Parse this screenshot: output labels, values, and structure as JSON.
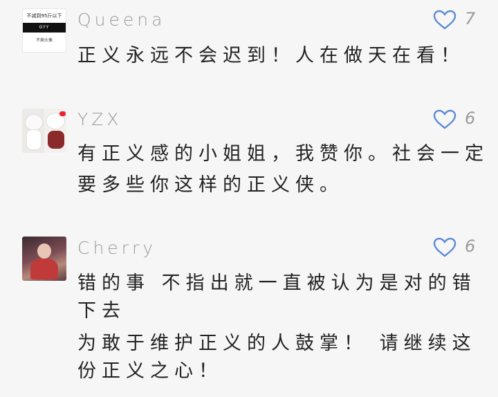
{
  "comments": [
    {
      "username": "Queena",
      "likes": "7",
      "avatar_text": {
        "top": "不减到95斤以下",
        "bar": "GYY",
        "bottom": "不换头像"
      },
      "lines": [
        "正义永远不会迟到！人在做天在看！"
      ]
    },
    {
      "username": "YZX",
      "likes": "6",
      "lines": [
        "有正义感的小姐姐，我赞你。社会一定",
        "要多些你这样的正义侠。"
      ]
    },
    {
      "username": "Cherry",
      "likes": "6",
      "lines": [
        "错的事 不指出就一直被认为是对的错",
        "下去",
        "为敢于维护正义的人鼓掌！ 请继续这",
        "份正义之心！"
      ]
    }
  ],
  "colors": {
    "heart": "#5b8bd6",
    "username": "#9a9a9a",
    "text": "#222222"
  }
}
